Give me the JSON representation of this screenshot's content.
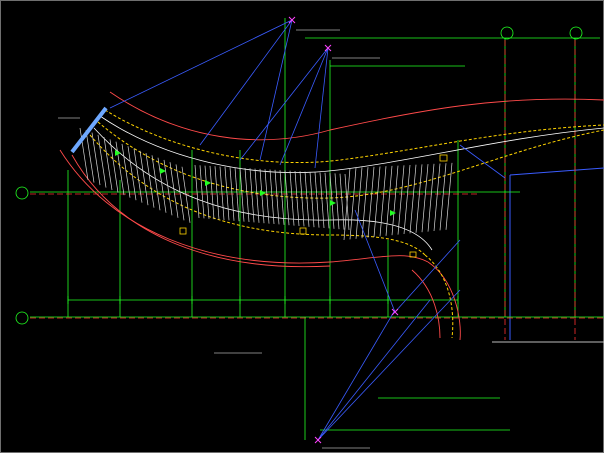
{
  "drawing": {
    "title": "",
    "scale": "",
    "grid_markers": {
      "top_left": "",
      "top_right": "",
      "left_upper": "",
      "left_lower": ""
    },
    "callouts": {
      "top": "",
      "mid": "",
      "bottom": "",
      "left": ""
    }
  },
  "colors": {
    "background": "#000000",
    "curb_red": "#ff4a4a",
    "axis_green": "#22ff22",
    "dashed_yellow": "#ffd400",
    "rail_white": "#ffffff",
    "leader_blue": "#3a5cff",
    "frame_white": "#c8c8c8"
  }
}
